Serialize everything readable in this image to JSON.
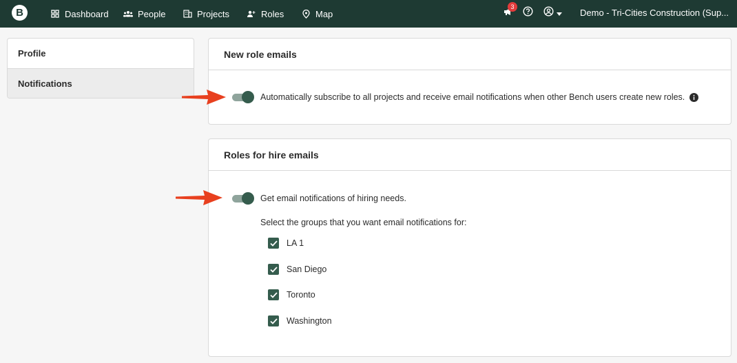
{
  "topnav": {
    "logo": "B",
    "items": [
      {
        "label": "Dashboard",
        "icon": "grid-icon"
      },
      {
        "label": "People",
        "icon": "people-icon"
      },
      {
        "label": "Projects",
        "icon": "building-icon"
      },
      {
        "label": "Roles",
        "icon": "roles-icon"
      },
      {
        "label": "Map",
        "icon": "map-pin-icon"
      }
    ],
    "notification_count": "3",
    "org_name": "Demo - Tri-Cities Construction (Sup..."
  },
  "sidebar": {
    "items": [
      {
        "label": "Profile",
        "active": false
      },
      {
        "label": "Notifications",
        "active": true
      }
    ]
  },
  "new_role_emails": {
    "title": "New role emails",
    "toggle_on": true,
    "toggle_label": "Automatically subscribe to all projects and receive email notifications when other Bench users create new roles."
  },
  "roles_for_hire": {
    "title": "Roles for hire emails",
    "toggle_on": true,
    "toggle_label": "Get email notifications of hiring needs.",
    "groups_label": "Select the groups that you want email notifications for:",
    "groups": [
      {
        "label": "LA 1",
        "checked": true
      },
      {
        "label": "San Diego",
        "checked": true
      },
      {
        "label": "Toronto",
        "checked": true
      },
      {
        "label": "Washington",
        "checked": true
      }
    ]
  },
  "colors": {
    "nav_bg": "#1e3a33",
    "accent": "#355c4d",
    "badge": "#e23b3b",
    "arrow": "#e8401f"
  }
}
